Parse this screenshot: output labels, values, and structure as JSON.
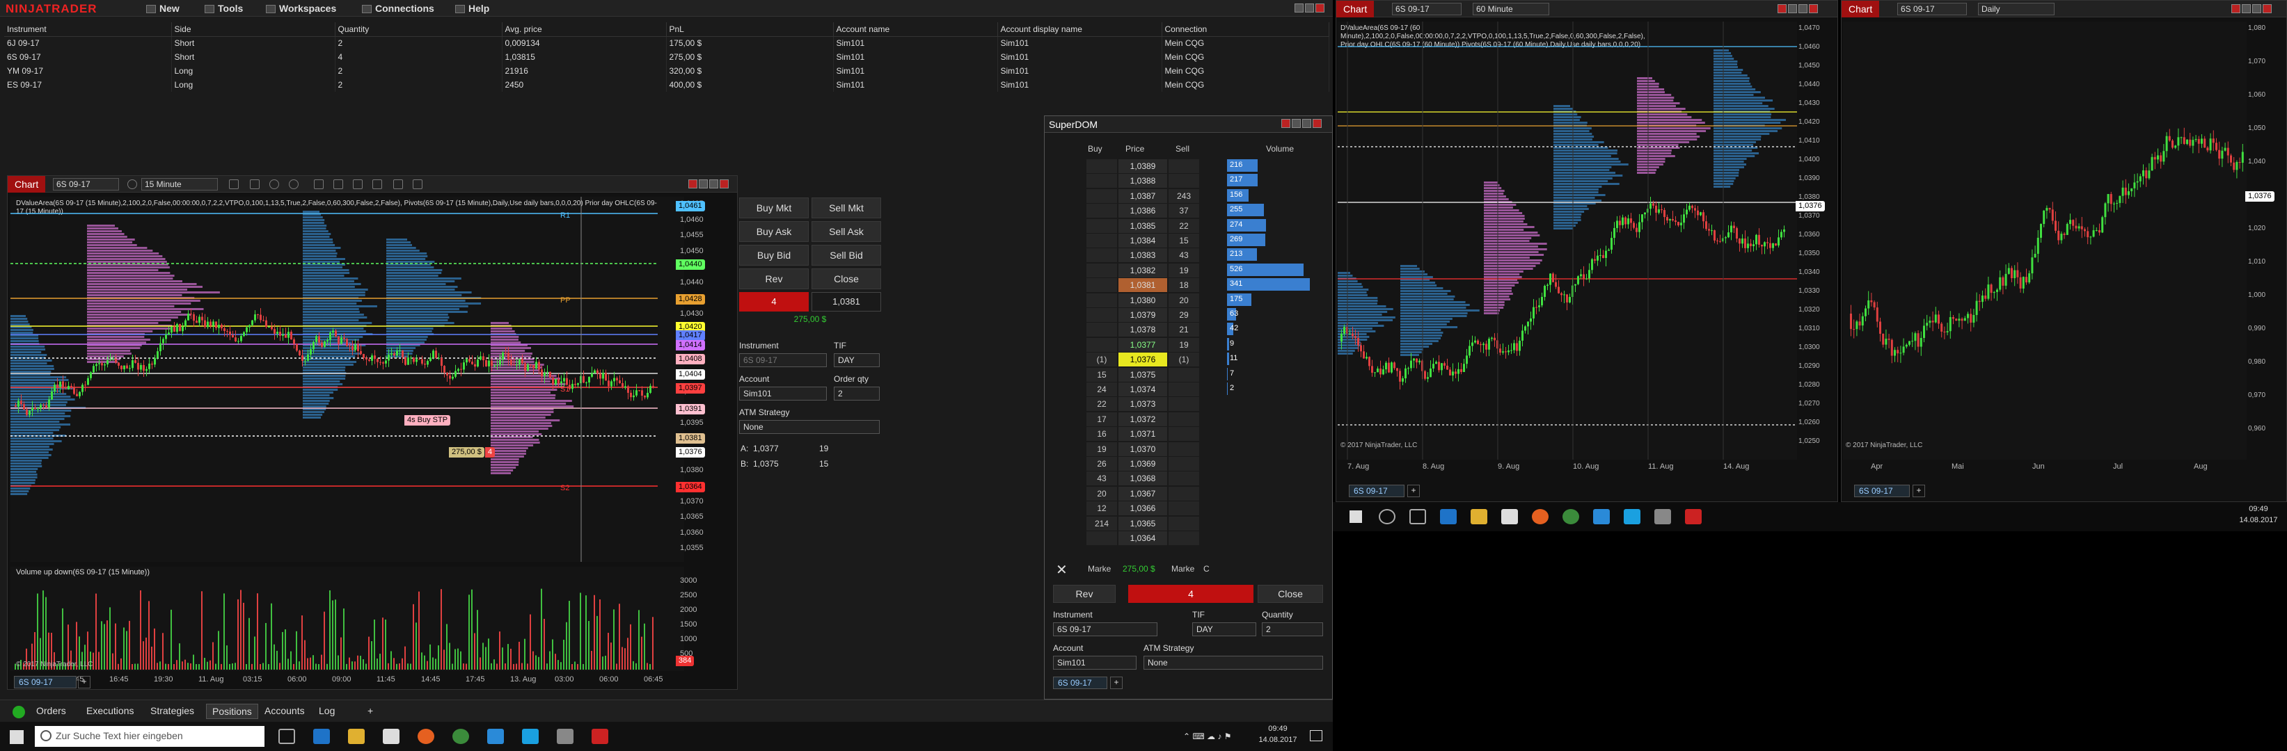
{
  "app": {
    "name": "NINJATRADER"
  },
  "menu": [
    "New",
    "Tools",
    "Workspaces",
    "Connections",
    "Help"
  ],
  "positions": {
    "headers": [
      "Instrument",
      "Side",
      "Quantity",
      "Avg. price",
      "PnL",
      "Account name",
      "Account display name",
      "Connection"
    ],
    "rows": [
      [
        "6J 09-17",
        "Short",
        "2",
        "0,009134",
        "175,00 $",
        "Sim101",
        "Sim101",
        "Mein CQG"
      ],
      [
        "6S 09-17",
        "Short",
        "4",
        "1,03815",
        "275,00 $",
        "Sim101",
        "Sim101",
        "Mein CQG"
      ],
      [
        "YM 09-17",
        "Long",
        "2",
        "21916",
        "320,00 $",
        "Sim101",
        "Sim101",
        "Mein CQG"
      ],
      [
        "ES 09-17",
        "Long",
        "2",
        "2450",
        "400,00 $",
        "Sim101",
        "Sim101",
        "Mein CQG"
      ]
    ]
  },
  "main_chart": {
    "tab": "Chart",
    "instrument": "6S 09-17",
    "interval": "15 Minute",
    "study_text": "DValueArea(6S 09-17 (15 Minute),2,100,2,0,False,00:00:00,0,7,2,2,VTPO,0,100,1,13,5,True,2,False,0,60,300,False,2,False), Pivots(6S 09-17 (15 Minute),Daily,Use daily bars,0,0,0,20)  Prior day OHLC(6S 09-17 (15 Minute))",
    "price_ticks": [
      "1,0465",
      "1,0460",
      "1,0455",
      "1,0450",
      "1,0445",
      "1,0440",
      "1,0435",
      "1,0430",
      "1,0425",
      "1,0420",
      "1,0415",
      "1,0410",
      "1,0405",
      "1,0400",
      "1,0395",
      "1,0390",
      "1,0385",
      "1,0380",
      "1,0375",
      "1,0370",
      "1,0365",
      "1,0360",
      "1,0355"
    ],
    "price_labels": [
      {
        "t": "1,0461",
        "c": "#4fc0ff"
      },
      {
        "t": "1,0440",
        "c": "#60ff60"
      },
      {
        "t": "1,0428",
        "c": "#e8a030"
      },
      {
        "t": "1,0420",
        "c": "#ffff30"
      },
      {
        "t": "1,0417",
        "c": "#6080ff"
      },
      {
        "t": "1,0414",
        "c": "#d070ff"
      },
      {
        "t": "1,0408",
        "c": "#ffb0c0"
      },
      {
        "t": "1,0404",
        "c": "#ffffff"
      },
      {
        "t": "1,0397",
        "c": "#ff4040"
      },
      {
        "t": "1,0391",
        "c": "#ffc0d0"
      },
      {
        "t": "1,0381",
        "c": "#e0c090"
      },
      {
        "t": "1,0376",
        "c": "#ffffff"
      },
      {
        "t": "1,0364",
        "c": "#ff3030"
      }
    ],
    "line_labels": [
      "R1",
      "PP",
      "S1",
      "S2"
    ],
    "order_tags": {
      "buy_stop": "4s  Buy STP",
      "pos": "275,00 $",
      "qty": "4"
    },
    "time_ticks": [
      "16:45",
      "13:45",
      "16:45",
      "19:30",
      "11. Aug",
      "03:15",
      "06:00",
      "09:00",
      "11:45",
      "14:45",
      "17:45",
      "13. Aug",
      "03:00",
      "06:00",
      "06:45"
    ],
    "volume_title": "Volume up down(6S 09-17 (15 Minute))",
    "volume_ticks": [
      "3000",
      "2500",
      "2000",
      "1500",
      "1000",
      "500"
    ],
    "volume_label": "384",
    "copyright": "© 2017 NinjaTrader, LLC",
    "bottom_tab": "6S 09-17"
  },
  "chart_trader": {
    "buy_mkt": "Buy Mkt",
    "sell_mkt": "Sell Mkt",
    "buy_ask": "Buy Ask",
    "sell_ask": "Sell Ask",
    "buy_bid": "Buy Bid",
    "sell_bid": "Sell Bid",
    "rev": "Rev",
    "close": "Close",
    "pos_qty": "4",
    "pos_price": "1,0381",
    "pnl": "275,00 $",
    "instrument_label": "Instrument",
    "instrument": "6S 09-17",
    "tif_label": "TIF",
    "tif": "DAY",
    "account_label": "Account",
    "account": "Sim101",
    "qty_label": "Order qty",
    "qty": "2",
    "atm_label": "ATM Strategy",
    "atm": "None",
    "a_label": "A:",
    "a_price": "1,0377",
    "a_size": "19",
    "b_label": "B:",
    "b_price": "1,0375",
    "b_size": "15"
  },
  "superdom": {
    "title": "SuperDOM",
    "headers": {
      "buy": "Buy",
      "price": "Price",
      "sell": "Sell",
      "volume": "Volume"
    },
    "rows": [
      {
        "buy": "",
        "price": "1,0389",
        "sell": "",
        "vol": "216",
        "w": 0.35
      },
      {
        "buy": "",
        "price": "1,0388",
        "sell": "",
        "vol": "217",
        "w": 0.35
      },
      {
        "buy": "",
        "price": "1,0387",
        "sell": "243",
        "vol": "156",
        "w": 0.25
      },
      {
        "buy": "",
        "price": "1,0386",
        "sell": "37",
        "vol": "255",
        "w": 0.42
      },
      {
        "buy": "",
        "price": "1,0385",
        "sell": "22",
        "vol": "274",
        "w": 0.45
      },
      {
        "buy": "",
        "price": "1,0384",
        "sell": "15",
        "vol": "269",
        "w": 0.44
      },
      {
        "buy": "",
        "price": "1,0383",
        "sell": "43",
        "vol": "213",
        "w": 0.34
      },
      {
        "buy": "",
        "price": "1,0382",
        "sell": "19",
        "vol": "526",
        "w": 0.88
      },
      {
        "buy": "",
        "price": "1,0381",
        "sell": "18",
        "vol": "341",
        "w": 0.95
      },
      {
        "buy": "",
        "price": "1,0380",
        "sell": "20",
        "vol": "175",
        "w": 0.28
      },
      {
        "buy": "",
        "price": "1,0379",
        "sell": "29",
        "vol": "63",
        "w": 0.1
      },
      {
        "buy": "",
        "price": "1,0378",
        "sell": "21",
        "vol": "42",
        "w": 0.07
      },
      {
        "buy": "",
        "price": "1,0377",
        "sell": "19",
        "vol": "9",
        "w": 0.02
      },
      {
        "buy": "(1)",
        "price": "1,0376",
        "sell": "(1)",
        "vol": "11",
        "w": 0.02
      },
      {
        "buy": "15",
        "price": "1,0375",
        "sell": "",
        "vol": "7",
        "w": 0.01
      },
      {
        "buy": "24",
        "price": "1,0374",
        "sell": "",
        "vol": "2",
        "w": 0.005
      },
      {
        "buy": "22",
        "price": "1,0373",
        "sell": "",
        "vol": "",
        "w": 0
      },
      {
        "buy": "17",
        "price": "1,0372",
        "sell": "",
        "vol": "",
        "w": 0
      },
      {
        "buy": "16",
        "price": "1,0371",
        "sell": "",
        "vol": "",
        "w": 0
      },
      {
        "buy": "19",
        "price": "1,0370",
        "sell": "",
        "vol": "",
        "w": 0
      },
      {
        "buy": "26",
        "price": "1,0369",
        "sell": "",
        "vol": "",
        "w": 0
      },
      {
        "buy": "43",
        "price": "1,0368",
        "sell": "",
        "vol": "",
        "w": 0
      },
      {
        "buy": "20",
        "price": "1,0367",
        "sell": "",
        "vol": "",
        "w": 0
      },
      {
        "buy": "12",
        "price": "1,0366",
        "sell": "",
        "vol": "",
        "w": 0
      },
      {
        "buy": "214",
        "price": "1,0365",
        "sell": "",
        "vol": "",
        "w": 0
      },
      {
        "buy": "",
        "price": "1,0364",
        "sell": "",
        "vol": "",
        "w": 0
      }
    ],
    "market_left": "Marke",
    "pnl": "275,00 $",
    "market_right": "Marke",
    "c": "C",
    "rev": "Rev",
    "pos": "4",
    "close": "Close",
    "instrument_label": "Instrument",
    "instrument": "6S 09-17",
    "tif_label": "TIF",
    "tif": "DAY",
    "qty_label": "Quantity",
    "qty": "2",
    "account_label": "Account",
    "account": "Sim101",
    "atm_label": "ATM Strategy",
    "atm": "None",
    "bottom_tab": "6S 09-17"
  },
  "chart2": {
    "tab": "Chart",
    "instrument": "6S 09-17",
    "interval": "60 Minute",
    "study_text": "DValueArea(6S 09-17 (60 Minute),2,100,2,0,False,00:00:00,0,7,2,2,VTPO,0,100,1,13,5,True,2,False,0,60,300,False,2,False), Prior day OHLC(6S 09-17 (60 Minute)) Pivots(6S 09-17 (60 Minute),Daily,Use daily bars,0,0,0,20)",
    "price_ticks": [
      "1,0470",
      "1,0460",
      "1,0450",
      "1,0440",
      "1,0430",
      "1,0420",
      "1,0410",
      "1,0400",
      "1,0390",
      "1,0380",
      "1,0370",
      "1,0360",
      "1,0350",
      "1,0340",
      "1,0330",
      "1,0320",
      "1,0310",
      "1,0300",
      "1,0290",
      "1,0280",
      "1,0270",
      "1,0260",
      "1,0250"
    ],
    "current": "1,0376",
    "time_ticks": [
      "7. Aug",
      "8. Aug",
      "9. Aug",
      "10. Aug",
      "11. Aug",
      "14. Aug"
    ],
    "copyright": "© 2017 NinjaTrader, LLC",
    "bottom_tab": "6S 09-17"
  },
  "chart3": {
    "tab": "Chart",
    "instrument": "6S 09-17",
    "interval": "Daily",
    "price_ticks": [
      "1,080",
      "1,070",
      "1,060",
      "1,050",
      "1,040",
      "1,030",
      "1,020",
      "1,010",
      "1,000",
      "0,990",
      "0,980",
      "0,970",
      "0,960"
    ],
    "current": "1,0376",
    "time_ticks": [
      "Apr",
      "Mai",
      "Jun",
      "Jul",
      "Aug"
    ],
    "copyright": "© 2017 NinjaTrader, LLC",
    "bottom_tab": "6S 09-17"
  },
  "bottom_tabs": [
    "Orders",
    "Executions",
    "Strategies",
    "Positions",
    "Accounts",
    "Log"
  ],
  "taskbar": {
    "search": "Zur Suche Text hier eingeben",
    "time": "09:49",
    "date": "14.08.2017"
  },
  "taskbar2": {
    "time": "09:49",
    "date": "14.08.2017"
  }
}
